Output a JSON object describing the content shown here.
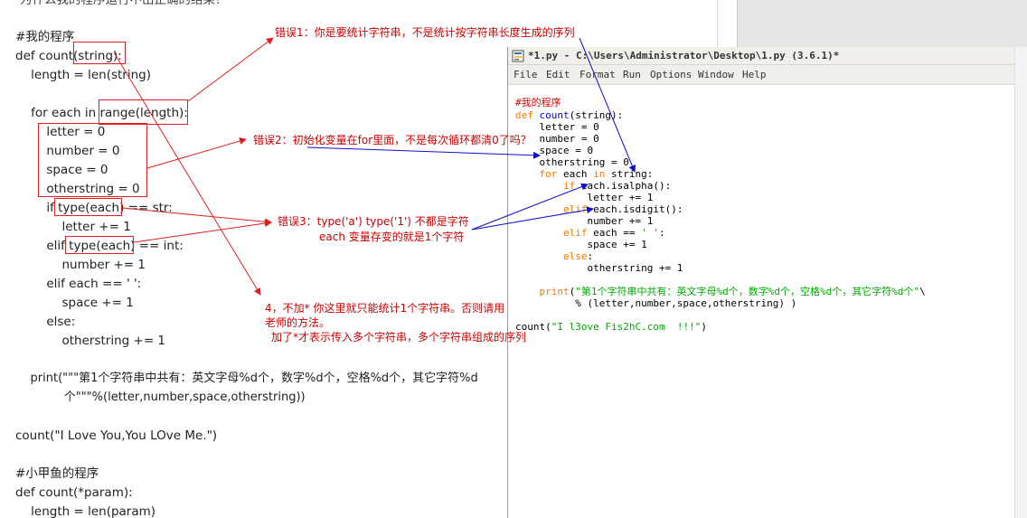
{
  "post": {
    "top_cut": "为什么我的程序运行不出正确的结果？",
    "lines": [
      "#我的程序",
      "def count(string):",
      "    length = len(string)",
      "",
      "    for each in range(length):",
      "        letter = 0",
      "        number = 0",
      "        space = 0",
      "        otherstring = 0",
      "        if type(each) == str:",
      "            letter += 1",
      "        elif type(each) == int:",
      "            number += 1",
      "        elif each == ' ':",
      "            space += 1",
      "        else:",
      "            otherstring += 1",
      "",
      "    print(\"\"\"第1个字符串中共有：英文字母%d个，数字%d个，空格%d个，其它字符%d",
      "             个\"\"\"%(letter,number,space,otherstring))",
      "",
      "count(\"I Love You,You LOve Me.\")",
      "",
      "#小甲鱼的程序",
      "def count(*param):",
      "    length = len(param)"
    ]
  },
  "idle": {
    "title": "*1.py - C:\\Users\\Administrator\\Desktop\\1.py (3.6.1)*",
    "menu": [
      "File",
      "Edit",
      "Format",
      "Run",
      "Options",
      "Window",
      "Help"
    ],
    "code": {
      "l1": "#我的程序",
      "l2a": "def",
      "l2b": " count",
      "l2c": "(string):",
      "l3": "    letter = 0",
      "l4": "    number = 0",
      "l5": "    space = 0",
      "l6": "    otherstring = 0",
      "l7a": "    for",
      "l7b": " each ",
      "l7c": "in",
      "l7d": " string:",
      "l8a": "        if",
      "l8b": " each.isalpha():",
      "l9": "            letter += 1",
      "l10a": "        elif",
      "l10b": " each.isdigit():",
      "l11": "            number += 1",
      "l12a": "        elif",
      "l12b": " each == ",
      "l12c": "' '",
      "l12d": ":",
      "l13": "            space += 1",
      "l14a": "        else",
      "l14b": ":",
      "l15": "            otherstring += 1",
      "l16a": "    print",
      "l16b": "(",
      "l16c": "\"第1个字符串中共有：英文字母%d个，数字%d个，空格%d个，其它字符%d个\"",
      "l16d": "\\",
      "l17": "          % (letter,number,space,otherstring) )",
      "l18a": "count(",
      "l18b": "\"I l3ove Fis2hC.com  !!!\"",
      "l18c": ")"
    }
  },
  "annotations": {
    "a1": "错误1：你是要统计字符串，不是统计按字符串长度生成的序列",
    "a2": "错误2：初始化变量在for里面，不是每次循环都清0了吗？",
    "a3_1": "错误3：type('a') type('1') 不都是字符",
    "a3_2": "each 变量存变的就是1个字符",
    "a4_1": "4，不加* 你这里就只能统计1个字符串。否则请用",
    "a4_2": "老师的方法。",
    "a4_3": "加了*才表示传入多个字符串，多个字符串组成的序列"
  },
  "colors": {
    "annotation": "#cc0000",
    "red_arrow": "#e02020",
    "blue_arrow": "#1010cc"
  }
}
